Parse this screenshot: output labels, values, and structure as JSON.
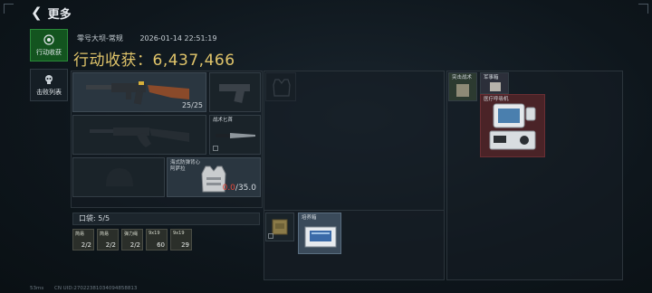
{
  "topbar": {
    "back_label": "更多"
  },
  "sidebar": {
    "tabs": [
      {
        "label": "行动收获"
      },
      {
        "label": "击败列表"
      }
    ]
  },
  "header": {
    "map_mode": "零号大坝-常规",
    "datetime": "2026-01-14 22:51:19",
    "headline": "行动收获：6,437,466"
  },
  "loadout": {
    "primary_ammo": "25/25",
    "melee_name": "战术匕首",
    "armor_name": "海式防弹背心\n阿萨拉",
    "armor_durability_current": "0.0",
    "armor_durability_sep": "/35.0"
  },
  "pockets": {
    "label": "口袋: 5/5",
    "items": [
      {
        "name": "简易",
        "count": "2/2"
      },
      {
        "name": "简易",
        "count": "2/2"
      },
      {
        "name": "弹力绳",
        "count": "2/2"
      },
      {
        "name": "9x19",
        "count": "60"
      },
      {
        "name": "9x19",
        "count": "29"
      }
    ]
  },
  "backpack": {
    "item_name": "培养箱"
  },
  "safebox": {
    "item1_name": "突击战术",
    "item2_name": "军事箱",
    "item3_name": "医疗呼吸机"
  },
  "footer": {
    "ping": "53ms",
    "uid": "CN UID:27022381034094858813"
  },
  "colors": {
    "accent_gold": "#e0c46a",
    "active_tab": "#13541f",
    "durability_bad": "#e5483a",
    "rare_bg": "#4a2327"
  }
}
